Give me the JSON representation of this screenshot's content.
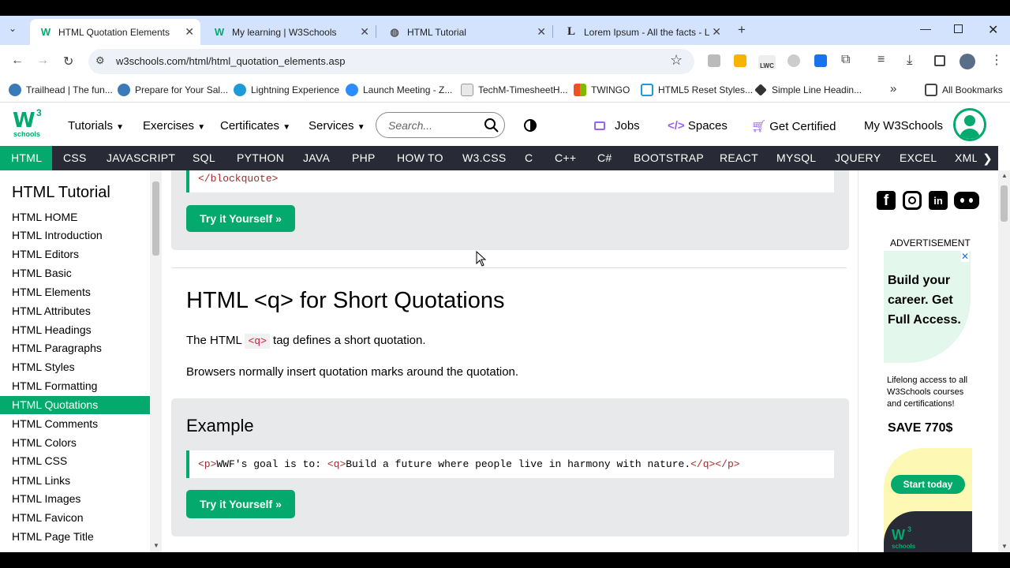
{
  "browser": {
    "tabs": [
      {
        "title": "HTML Quotation Elements",
        "favicon": "w3schools-icon",
        "active": true
      },
      {
        "title": "My learning | W3Schools",
        "favicon": "w3schools-icon",
        "active": false
      },
      {
        "title": "HTML Tutorial",
        "favicon": "globe-icon",
        "active": false
      },
      {
        "title": "Lorem Ipsum - All the facts - Lip",
        "favicon": "lipsum-icon",
        "active": false
      }
    ],
    "url": "w3schools.com/html/html_quotation_elements.asp",
    "extension_badge": "LWC",
    "bookmarks": [
      {
        "label": "Trailhead | The fun..."
      },
      {
        "label": "Prepare for Your Sal..."
      },
      {
        "label": "Lightning Experience"
      },
      {
        "label": "Launch Meeting - Z..."
      },
      {
        "label": "TechM-TimesheetH..."
      },
      {
        "label": "TWINGO"
      },
      {
        "label": "HTML5 Reset Styles..."
      },
      {
        "label": "Simple Line Headin..."
      }
    ],
    "all_bookmarks": "All Bookmarks"
  },
  "header": {
    "logo_sup": "3",
    "logo_sub": "schools",
    "menus": [
      "Tutorials",
      "Exercises",
      "Certificates",
      "Services"
    ],
    "search_placeholder": "Search...",
    "links": [
      "Jobs",
      "Spaces",
      "Get Certified",
      "My W3Schools"
    ]
  },
  "topnav": [
    "HTML",
    "CSS",
    "JAVASCRIPT",
    "SQL",
    "PYTHON",
    "JAVA",
    "PHP",
    "HOW TO",
    "W3.CSS",
    "C",
    "C++",
    "C#",
    "BOOTSTRAP",
    "REACT",
    "MYSQL",
    "JQUERY",
    "EXCEL",
    "XML"
  ],
  "sidebar": {
    "title": "HTML Tutorial",
    "items": [
      "HTML HOME",
      "HTML Introduction",
      "HTML Editors",
      "HTML Basic",
      "HTML Elements",
      "HTML Attributes",
      "HTML Headings",
      "HTML Paragraphs",
      "HTML Styles",
      "HTML Formatting",
      "HTML Quotations",
      "HTML Comments",
      "HTML Colors",
      "HTML CSS",
      "HTML Links",
      "HTML Images",
      "HTML Favicon",
      "HTML Page Title"
    ],
    "active_index": 10
  },
  "main": {
    "prev_code": "</blockquote>",
    "try_label": "Try it Yourself »",
    "heading": "HTML <q> for Short Quotations",
    "para1_before": "The HTML ",
    "para1_code": "<q>",
    "para1_after": " tag defines a short quotation.",
    "para2": "Browsers normally insert quotation marks around the quotation.",
    "example_title": "Example",
    "code_line": {
      "p_open": "<p>",
      "text1": "WWF's goal is to: ",
      "q_open": "<q>",
      "text2": "Build a future where people live in harmony with nature.",
      "q_close": "</q>",
      "p_close": "</p>"
    }
  },
  "ad": {
    "label": "ADVERTISEMENT",
    "headline": "Build your career. Get Full Access.",
    "body": "Lifelong access to all W3Schools courses and certifications!",
    "save": "SAVE 770$",
    "cta": "Start today",
    "logo_sup": "3",
    "logo_sub": "schools"
  },
  "colors": {
    "brand_green": "#04aa6d",
    "nav_dark": "#282a35",
    "example_bg": "#e7e9eb"
  }
}
